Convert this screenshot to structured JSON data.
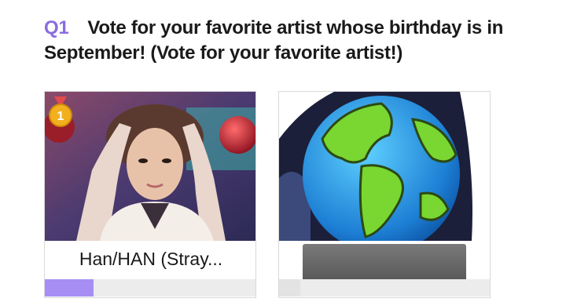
{
  "question": {
    "number": "Q1",
    "text": "Vote for your favorite artist whose birthday is in September! (Vote for your favorite artist!)"
  },
  "candidates": [
    {
      "name": "Han/HAN (Stray...",
      "rank": "1",
      "vote_share": 0.23,
      "icon": "rank-medal-icon"
    },
    {
      "name": "",
      "vote_share": 0.1,
      "icon": "globe-icon"
    }
  ],
  "colors": {
    "accent": "#8b6ce0",
    "progress_fill": "#a78ef5",
    "progress_track": "#ececec",
    "medal": "#f2b01e"
  }
}
